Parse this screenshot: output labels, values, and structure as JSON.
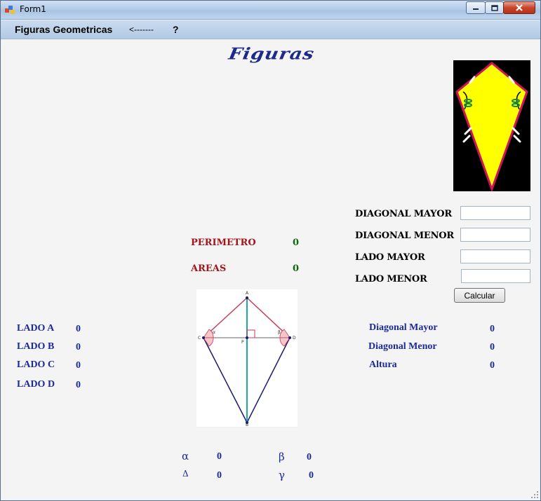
{
  "window": {
    "title": "Form1"
  },
  "menu": {
    "figuras": "Figuras Geometricas",
    "back": "<-------",
    "help": "?"
  },
  "header": {
    "title": "Figuras"
  },
  "form": {
    "diagonal_mayor_label": "DIAGONAL MAYOR",
    "diagonal_menor_label": "DIAGONAL MENOR",
    "lado_mayor_label": "LADO MAYOR",
    "lado_menor_label": "LADO MENOR",
    "diagonal_mayor_value": "",
    "diagonal_menor_value": "",
    "lado_mayor_value": "",
    "lado_menor_value": "",
    "calcular_label": "Calcular"
  },
  "results": {
    "perimetro_label": "PERIMETRO",
    "perimetro_value": "0",
    "areas_label": "AREAS",
    "areas_value": "0"
  },
  "lados": [
    {
      "label": "LADO A",
      "value": "0"
    },
    {
      "label": "LADO B",
      "value": "0"
    },
    {
      "label": "LADO C",
      "value": "0"
    },
    {
      "label": "LADO D",
      "value": "0"
    }
  ],
  "medidas": [
    {
      "label": "Diagonal Mayor",
      "value": "0"
    },
    {
      "label": "Diagonal Menor",
      "value": "0"
    },
    {
      "label": "Altura",
      "value": "0"
    }
  ],
  "angulos": [
    {
      "symbol": "α",
      "value": "0"
    },
    {
      "symbol": "β",
      "value": "0"
    },
    {
      "symbol": "Δ",
      "value": "0"
    },
    {
      "symbol": "γ",
      "value": "0"
    }
  ],
  "diagram_labels": {
    "a": "A",
    "b": "B",
    "c": "C",
    "d": "D",
    "p": "P",
    "alpha": "α",
    "beta": "β"
  },
  "colors": {
    "title_blue": "#1d2a8a",
    "label_red": "#a3151a",
    "value_green": "#0a6a0a",
    "text_blue": "#1a2a9c",
    "kite_yellow": "#ffff00",
    "kite_border": "#d0145a"
  }
}
